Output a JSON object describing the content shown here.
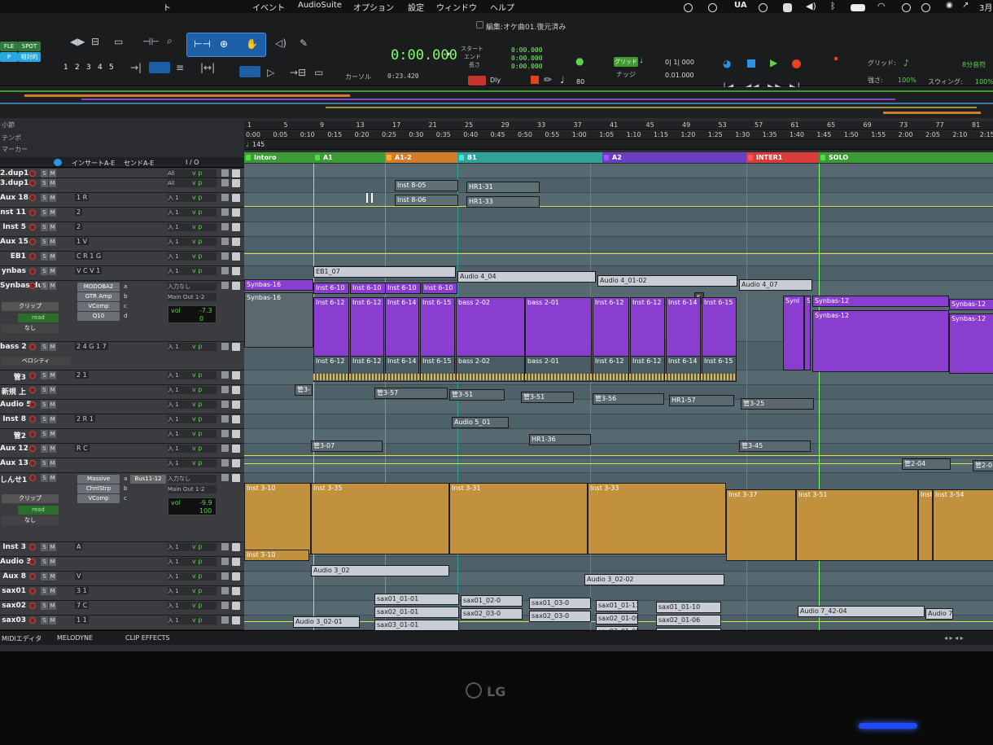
{
  "menu": {
    "items": [
      "ト",
      "イベント",
      "AudioSuite",
      "オプション",
      "設定",
      "ウィンドウ",
      "ヘルプ"
    ],
    "status": [
      "UA",
      "3月"
    ]
  },
  "window": {
    "title": "編集:オケ曲01.復元済み"
  },
  "toolbar": {
    "modes": [
      "FLE",
      "SPOT"
    ],
    "mode_value": "相対的",
    "grid_numbers": [
      "1",
      "2",
      "3",
      "4",
      "5"
    ],
    "main_counter": "0:00.000",
    "cursor_label": "カーソル",
    "cursor_value": "0:23.420",
    "start_label": "スタート",
    "end_label": "エンド",
    "length_label": "長さ",
    "start_value": "0:00.000",
    "end_value": "0:00.000",
    "length_value": "0:00.000",
    "dly_label": "Dly",
    "tempo_value": "80",
    "grid_btn": "グリッド",
    "grid_value": "0| 1| 000",
    "nudge_label": "ナッジ",
    "nudge_value": "0.01.000",
    "grid_label": "グリッド:",
    "grid_note": "8分音符",
    "strength_label": "強さ:",
    "strength_value": "100%",
    "swing_label": "スウィング:",
    "swing_value": "100%"
  },
  "ruler": {
    "labels": [
      "小節",
      "テンポ",
      "マーカー"
    ],
    "bars": [
      "1",
      "5",
      "9",
      "13",
      "17",
      "21",
      "25",
      "29",
      "33",
      "37",
      "41",
      "45",
      "49",
      "53",
      "57",
      "61",
      "65",
      "69",
      "73",
      "77",
      "81"
    ],
    "times": [
      "0:00",
      "0:05",
      "0:10",
      "0:15",
      "0:20",
      "0:25",
      "0:30",
      "0:35",
      "0:40",
      "0:45",
      "0:50",
      "0:55",
      "1:00",
      "1:05",
      "1:10",
      "1:15",
      "1:20",
      "1:25",
      "1:30",
      "1:35",
      "1:40",
      "1:45",
      "1:50",
      "1:55",
      "2:00",
      "2:05",
      "2:10",
      "2:15"
    ],
    "tempo": "145"
  },
  "markers": [
    {
      "label": "Intoro",
      "color": "#3b9b35"
    },
    {
      "label": "A1",
      "color": "#3b9b35"
    },
    {
      "label": "A1-2",
      "color": "#d57c2a"
    },
    {
      "label": "B1",
      "color": "#2fa39a"
    },
    {
      "label": "A2",
      "color": "#6a3fc0"
    },
    {
      "label": "INTER1",
      "color": "#d83c3c"
    },
    {
      "label": "SOLO",
      "color": "#3b9b35"
    }
  ],
  "columns": {
    "inserts": "インサートA-E",
    "sends": "センドA-E",
    "io": "I / O"
  },
  "tracks": [
    {
      "name": "2.dup1",
      "io": "All",
      "io2": "11"
    },
    {
      "name": "3.dup1",
      "io": "All",
      "io2": "71"
    },
    {
      "name": "Aux 18",
      "ins": "1 R",
      "io": "入 1"
    },
    {
      "name": "nst 11",
      "ins": "2",
      "io": "入 1"
    },
    {
      "name": "Inst 5",
      "ins": "2",
      "io": "入 1"
    },
    {
      "name": "Aux 15",
      "ins": "1 V",
      "io": "入 1"
    },
    {
      "name": "EB1",
      "ins": "C R 1 G",
      "io": "入 1"
    },
    {
      "name": "ynbas",
      "ins": "V C V 1",
      "io": "入 1"
    },
    {
      "name": "Synbas.dup1",
      "io": "入力なし",
      "out": "Main Out 1-2",
      "vol": "-7.3",
      "pan": "0",
      "plugins": [
        "MODOBA2",
        "GTR Amp",
        "VComp",
        "Q10"
      ],
      "clip": "クリップ",
      "dyn": "read",
      "none": "なし"
    },
    {
      "name": "bass 2",
      "ins": "2 4 G 1 7",
      "io": "入 1",
      "sub": "ベロシティ"
    },
    {
      "name": "管3",
      "ins": "2 1",
      "io": "入 1"
    },
    {
      "name": "新規 上",
      "io": "入 1"
    },
    {
      "name": "Audio 5",
      "io": "入 1"
    },
    {
      "name": "Inst 8",
      "ins": "2 R 1",
      "io": "入 1"
    },
    {
      "name": "管2",
      "io": "入 1"
    },
    {
      "name": "Aux 12",
      "ins": "R C",
      "io": "入 1"
    },
    {
      "name": "Aux 13",
      "io": "入 1"
    },
    {
      "name": "しんせ1",
      "io": "入力なし",
      "out": "Main Out 1-2",
      "vol": "-9.9",
      "pan": "100",
      "plugins": [
        "Massive",
        "ChnlStrp",
        "VComp"
      ],
      "send": "Bus11-12",
      "clip": "クリップ",
      "dyn": "read",
      "none": "なし"
    },
    {
      "name": "Inst 3",
      "ins": "A",
      "io": "入 1"
    },
    {
      "name": "Audio 3",
      "io": "入 1"
    },
    {
      "name": "Aux 8",
      "ins": "V",
      "io": "入 1"
    },
    {
      "name": "sax01",
      "ins": "3 1",
      "io": "入 1"
    },
    {
      "name": "sax02",
      "ins": "7 C",
      "io": "入 1"
    },
    {
      "name": "sax03",
      "ins": "1 1",
      "io": "入 1"
    }
  ],
  "clips": {
    "r0": [
      "Inst 8-05",
      "HR1-31"
    ],
    "r1": [
      "Inst 8-06",
      "HR1-33"
    ],
    "eb1": [
      "EB1_07",
      "Audio 4_04",
      "Audio 4_01-02",
      "Audio 4_07"
    ],
    "syn_top": [
      "Synbas-16",
      "Inst 6-10",
      "Inst 6-10",
      "Inst 6-10",
      "Inst 6-10",
      "S"
    ],
    "syn_main": [
      "Synbas-16",
      "Inst 6-12",
      "Inst 6-12",
      "Inst 6-14",
      "Inst 6-15",
      "bass 2-02",
      "bass 2-01",
      "Inst 6-12",
      "Inst 6-12",
      "Inst 6-14",
      "Inst 6-15",
      "Synl",
      "S",
      "Synbas-12",
      "Synbas-12",
      "Synbas-12",
      "Synbas-12"
    ],
    "bass": [
      "Inst 6-12",
      "Inst 6-12",
      "Inst 6-14",
      "Inst 6-15",
      "bass 2-02",
      "bass 2-01",
      "Inst 6-12",
      "Inst 6-12",
      "Inst 6-14",
      "Inst 6-15"
    ],
    "kan3": [
      "管3-",
      "管3-57",
      "管3-51",
      "管3-51",
      "管3-56",
      "HR1-57",
      "管3-25"
    ],
    "audio5": [
      "Audio 5_01"
    ],
    "inst8": [
      "HR1-36"
    ],
    "kan2": [
      "管3-07",
      "管3-45"
    ],
    "aux13": [
      "管2-04",
      "管2-0"
    ],
    "shinse": [
      "Inst 3-10",
      "Inst 3-35",
      "Inst 3-31",
      "Inst 3-33",
      "Inst 3-37",
      "Inst 3-51",
      "Inst",
      "Inst 3-54"
    ],
    "inst3": [
      "Inst 3-10"
    ],
    "audio3": [
      "Audio 3_02",
      "Audio 3_02-02"
    ],
    "sax01": [
      "sax01_01-01",
      "sax01_02-0",
      "sax01_03-0",
      "sax01_01-13",
      "sax01_01-10",
      "Audio 7_42-04",
      "Audio 7"
    ],
    "sax02": [
      "sax02_01-01",
      "sax02_03-0",
      "sax02_03-0",
      "sax02_01-09",
      "sax02_01-06"
    ],
    "sax03": [
      "Audio 3_02-01",
      "sax03_01-01",
      "sax03_01-05",
      "sax03_01-07"
    ]
  },
  "bottom_tabs": [
    "MIDIエディタ",
    "MELODYNE",
    "CLIP EFFECTS"
  ],
  "monitor_brand": "LG",
  "colors": {
    "purple": "#8a3ed0",
    "gold": "#c2913d",
    "green": "#3b9b35",
    "red": "#d83c3c"
  }
}
